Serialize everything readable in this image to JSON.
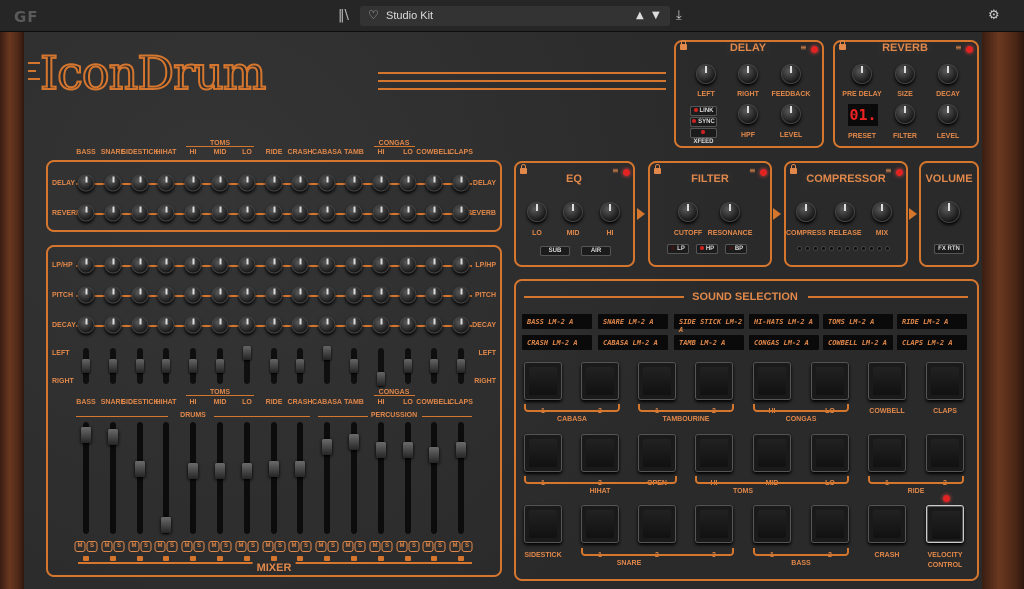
{
  "topbar": {
    "logo": "GF",
    "preset_name": "Studio Kit"
  },
  "brand": {
    "title": "IconDrum"
  },
  "channels": [
    "BASS",
    "SNARE",
    "SIDESTICK",
    "HIHAT",
    "HI",
    "MID",
    "LO",
    "RIDE",
    "CRASH",
    "CABASA",
    "TAMB",
    "HI",
    "LO",
    "COWBELL",
    "CLAPS"
  ],
  "group_labels": {
    "toms": "TOMS",
    "congas": "CONGAS",
    "drums": "DRUMS",
    "percussion": "PERCUSSION",
    "mixer": "MIXER"
  },
  "send_rows": {
    "delay": "DELAY",
    "reverb": "REVERB"
  },
  "channel_rows": {
    "lp_hp": "LP/HP",
    "pitch": "PITCH",
    "decay": "DECAY",
    "left": "LEFT",
    "right": "RIGHT"
  },
  "delay": {
    "title": "DELAY",
    "left": "LEFT",
    "right": "RIGHT",
    "feedback": "FEEDBACK",
    "hpf": "HPF",
    "level": "LEVEL",
    "link": "LINK",
    "sync": "SYNC",
    "xfeed": "XFEED"
  },
  "reverb": {
    "title": "REVERB",
    "pre_delay": "PRE DELAY",
    "size": "SIZE",
    "decay": "DECAY",
    "preset": "PRESET",
    "filter": "FILTER",
    "level": "LEVEL",
    "preset_value": "01."
  },
  "eq": {
    "title": "EQ",
    "lo": "LO",
    "mid": "MID",
    "hi": "HI",
    "sub": "SUB",
    "air": "AIR"
  },
  "filter": {
    "title": "FILTER",
    "cutoff": "CUTOFF",
    "resonance": "RESONANCE",
    "lp": "LP",
    "hp": "HP",
    "bp": "BP"
  },
  "compressor": {
    "title": "COMPRESSOR",
    "compress": "COMPRESS",
    "release": "RELEASE",
    "mix": "MIX"
  },
  "volume": {
    "title": "VOLUME",
    "fx_rtn": "FX RTN"
  },
  "sound_selection": {
    "title": "SOUND SELECTION",
    "slots": [
      "BASS LM-2 A",
      "SNARE LM-2 A",
      "SIDE STICK LM-2 A",
      "HI-HATS LM-2 A",
      "TOMS LM-2 A",
      "RIDE LM-2 A",
      "CRASH LM-2 A",
      "CABASA LM-2 A",
      "TAMB LM-2 A",
      "CONGAS LM-2 A",
      "COWBELL LM-2 A",
      "CLAPS LM-2 A"
    ],
    "row1": [
      "1",
      "2",
      "1",
      "2",
      "HI",
      "LO",
      "COWBELL",
      "CLAPS"
    ],
    "row1_groups": [
      "CABASA",
      "TAMBOURINE",
      "CONGAS"
    ],
    "row2": [
      "1",
      "2",
      "OPEN",
      "HI",
      "MID",
      "LO",
      "1",
      "2"
    ],
    "row2_groups": [
      "HIHAT",
      "TOMS",
      "RIDE"
    ],
    "row3": [
      "SIDESTICK",
      "1",
      "2",
      "3",
      "1",
      "2",
      "CRASH"
    ],
    "row3_groups": [
      "SNARE",
      "BASS"
    ],
    "velocity": "VELOCITY",
    "control": "CONTROL"
  },
  "mute_label": "M",
  "solo_label": "S",
  "channel_faders": [
    0.95,
    0.93,
    0.6,
    0.03,
    0.58,
    0.58,
    0.58,
    0.6,
    0.6,
    0.83,
    0.88,
    0.8,
    0.8,
    0.75,
    0.8
  ],
  "left_pan": [
    0.5,
    0.5,
    0.5,
    0.5,
    0.5,
    0.5,
    0.1,
    0.5,
    0.5,
    0.1,
    0.5,
    0.9,
    0.5,
    0.5,
    0.5
  ],
  "colors": {
    "accent": "#d5762f",
    "panel": "#2c2c2c",
    "led": "#e32222"
  }
}
